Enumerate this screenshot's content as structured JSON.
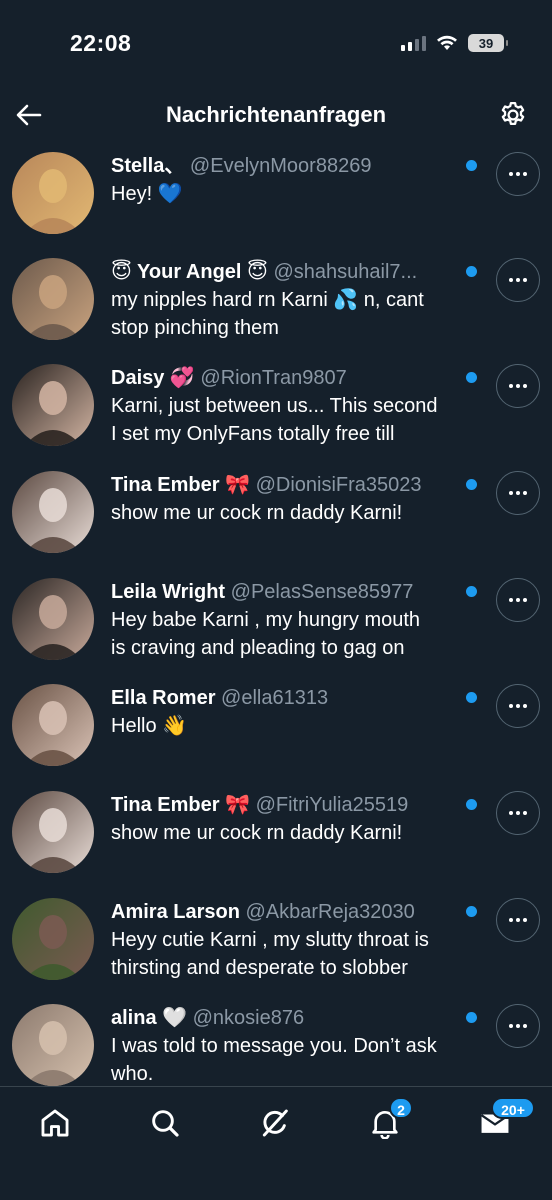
{
  "status_bar": {
    "time": "22:08",
    "battery": "39"
  },
  "header": {
    "title": "Nachrichtenanfragen"
  },
  "messages": [
    {
      "name": "Stella、",
      "handle": "@EvelynMoor88269",
      "text": "Hey!  💙",
      "line2": "",
      "avatar_colors": [
        "#b8875a",
        "#e2b873"
      ]
    },
    {
      "name": "😇 Your Angel 😇",
      "handle": "@shahsuhail7...",
      "text": "my nipples hard rn Karni 💦 n,  cant",
      "line2": "stop pinching them",
      "avatar_colors": [
        "#6d5a4c",
        "#c9a37f"
      ]
    },
    {
      "name": "Daisy 💞",
      "handle": "@RionTran9807",
      "text": "Karni, just between us... This second",
      "line2": "I set my OnlyFans totally free till",
      "avatar_colors": [
        "#2a2320",
        "#d3b5a3"
      ]
    },
    {
      "name": "Tina Ember 🎀",
      "handle": "@DionisiFra35023",
      "text": "show me ur cock rn daddy Karni!",
      "line2": "",
      "avatar_colors": [
        "#5c4a42",
        "#e8dcd6"
      ]
    },
    {
      "name": "Leila Wright",
      "handle": "@PelasSense85977",
      "text": "Hey babe Karni  , my hungry mouth",
      "line2": "is craving and pleading to gag on",
      "avatar_colors": [
        "#2b2624",
        "#c7a99a"
      ]
    },
    {
      "name": "Ella Romer",
      "handle": "@ella61313",
      "text": "Hello 👋",
      "line2": "",
      "avatar_colors": [
        "#6a5346",
        "#d9c2b5"
      ]
    },
    {
      "name": "Tina Ember 🎀",
      "handle": "@FitriYulia25519",
      "text": "show me ur cock rn daddy Karni!",
      "line2": "",
      "avatar_colors": [
        "#5c4a42",
        "#e8dcd6"
      ]
    },
    {
      "name": "Amira Larson",
      "handle": "@AkbarReja32030",
      "text": "Heyy cutie Karni  , my slutty throat is",
      "line2": "thirsting and desperate to slobber",
      "avatar_colors": [
        "#3f5a2e",
        "#7b5a52"
      ]
    },
    {
      "name": "alina 🤍",
      "handle": "@nkosie876",
      "text": "I was told to message you. Don’t ask",
      "line2": "who.",
      "avatar_colors": [
        "#8c7a6e",
        "#d6c1ae"
      ]
    }
  ],
  "nav": {
    "items": [
      "home-icon",
      "search-icon",
      "grok-icon",
      "notifications-icon",
      "messages-icon"
    ],
    "notifications_badge": "2",
    "messages_badge": "20+"
  },
  "colors": {
    "background": "#15202b",
    "accent": "#1d9bf0",
    "muted": "#8b98a5"
  }
}
